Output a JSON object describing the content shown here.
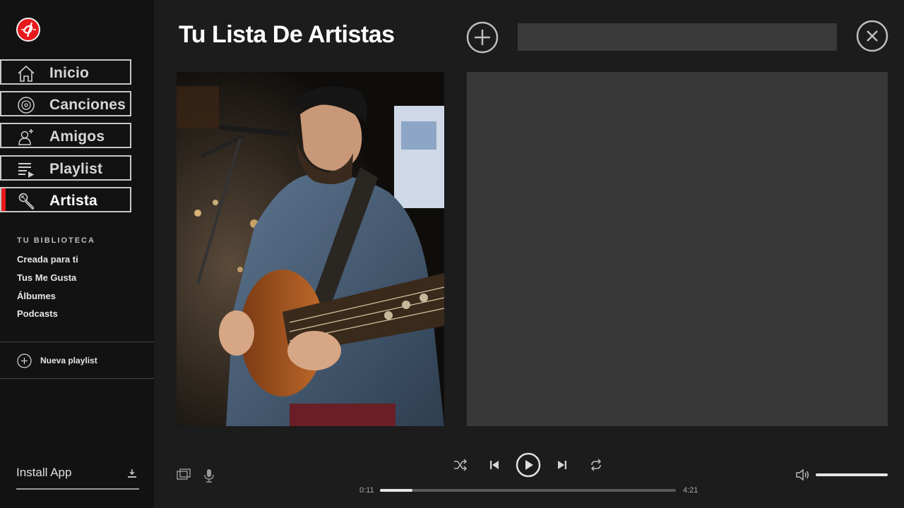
{
  "sidebar": {
    "nav": [
      {
        "label": "Inicio",
        "icon": "home-icon"
      },
      {
        "label": "Canciones",
        "icon": "disc-icon"
      },
      {
        "label": "Amigos",
        "icon": "add-friend-icon"
      },
      {
        "label": "Playlist",
        "icon": "playlist-icon"
      },
      {
        "label": "Artista",
        "icon": "microphone-icon",
        "active": true
      }
    ],
    "library": {
      "header": "TU BIBLIOTECA",
      "items": [
        "Creada para ti",
        "Tus Me Gusta",
        "Álbumes",
        "Podcasts"
      ]
    },
    "new_playlist": "Nueva playlist",
    "install_app": "Install App"
  },
  "main": {
    "title": "Tu Lista De Artistas",
    "search": {
      "value": "",
      "placeholder": ""
    }
  },
  "player": {
    "current_time": "0:11",
    "duration": "4:21",
    "progress": 0.11,
    "volume": 1.0
  },
  "colors": {
    "accent": "#e8191b",
    "sidebar_bg": "#121212",
    "main_bg": "#1c1c1c",
    "panel_bg": "#383838"
  }
}
